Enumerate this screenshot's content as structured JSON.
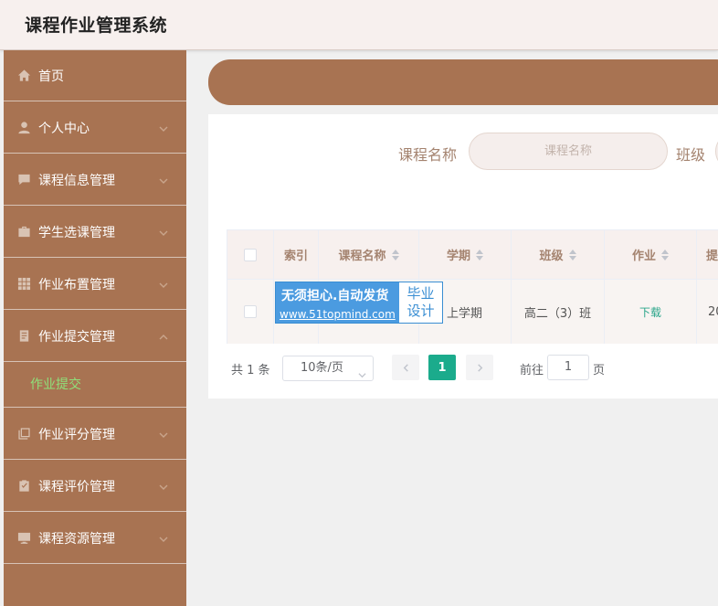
{
  "header": {
    "title": "课程作业管理系统"
  },
  "sidebar": {
    "items": [
      {
        "label": "首页",
        "icon": "home-icon"
      },
      {
        "label": "个人中心",
        "icon": "user-icon"
      },
      {
        "label": "课程信息管理",
        "icon": "chat-icon"
      },
      {
        "label": "学生选课管理",
        "icon": "briefcase-icon"
      },
      {
        "label": "作业布置管理",
        "icon": "grid-icon"
      },
      {
        "label": "作业提交管理",
        "icon": "document-icon"
      },
      {
        "label": "作业评分管理",
        "icon": "copy-icon"
      },
      {
        "label": "课程评价管理",
        "icon": "clipboard-icon"
      },
      {
        "label": "课程资源管理",
        "icon": "monitor-icon"
      }
    ],
    "submenu": {
      "label": "作业提交"
    }
  },
  "search": {
    "label1": "课程名称",
    "placeholder1": "课程名称",
    "label2": "班级"
  },
  "table": {
    "headers": {
      "index": "索引",
      "course": "课程名称",
      "term": "学期",
      "class": "班级",
      "homework": "作业",
      "submit": "提"
    },
    "rows": [
      {
        "term": "上学期",
        "class": "高二（3）班",
        "homework": "下载",
        "submit": "20"
      }
    ]
  },
  "watermark": {
    "line1": "无须担心.自动发货",
    "line2": "www.51topmind.com",
    "line3": "毕业",
    "line4": "设计"
  },
  "pagination": {
    "total": "共 1 条",
    "page_size": "10条/页",
    "current": "1",
    "goto_label": "前往",
    "goto_value": "1",
    "page_suffix": "页"
  },
  "colors": {
    "sidebar": "#a87352",
    "accent": "#1bab8c",
    "active_submenu": "#8fe07a"
  }
}
